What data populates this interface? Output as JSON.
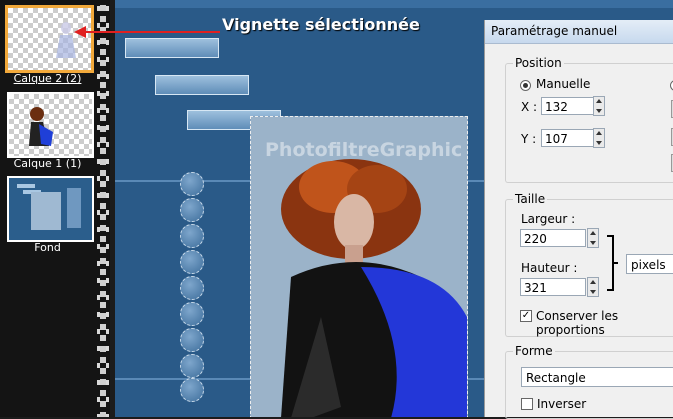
{
  "callout": {
    "text": "Vignette sélectionnée",
    "arrow_color": "#e02020"
  },
  "layers": [
    {
      "label": "Calque 2 (2)",
      "selected": true
    },
    {
      "label": "Calque 1 (1)",
      "selected": false
    },
    {
      "label": "Fond",
      "selected": false
    }
  ],
  "canvas": {
    "watermark": "PhotofiltreGraphic"
  },
  "dialog": {
    "title": "Paramétrage manuel",
    "position": {
      "group_label": "Position",
      "mode_label": "Manuelle",
      "x_label": "X :",
      "x_value": "132",
      "y_label": "Y :",
      "y_value": "107"
    },
    "size": {
      "group_label": "Taille",
      "width_label": "Largeur :",
      "width_value": "220",
      "height_label": "Hauteur :",
      "height_value": "321",
      "unit": "pixels",
      "keep_ratio_label": "Conserver les proportions",
      "keep_ratio_checked": true
    },
    "shape": {
      "group_label": "Forme",
      "value": "Rectangle",
      "invert_label": "Inverser",
      "invert_checked": false
    }
  },
  "colors": {
    "accent_selected": "#f2a93b",
    "canvas_blue": "#2a5a88"
  }
}
